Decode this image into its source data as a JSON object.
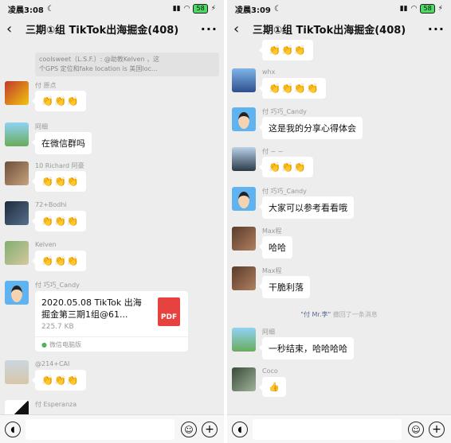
{
  "left": {
    "status": {
      "time": "凌晨3:08",
      "battery": "58"
    },
    "title": "三期①组 TikTok出海掘金(408)",
    "quote": {
      "line1": "coolsweet（L.S.F.）: @助教Kelven ，这",
      "line2": "个GPS 定位和fake location is  美国loc..."
    },
    "messages": [
      {
        "sender": "付 原点",
        "text": "👏👏👏"
      },
      {
        "sender": "阿细",
        "text": "在微信群吗"
      },
      {
        "sender": "10 Richard 阿豪",
        "text": "👏👏👏"
      },
      {
        "sender": "72+Bodhi",
        "text": "👏👏👏"
      },
      {
        "sender": "Kelven",
        "text": "👏👏👏"
      },
      {
        "sender": "付 巧巧_Candy"
      },
      {
        "sender": "@214+CAI",
        "text": "👏👏👏"
      },
      {
        "sender": "付 Esperanza"
      }
    ],
    "file": {
      "name": "2020.05.08 TikTok 出海掘金第三期1组@61...",
      "size": "225.7 KB",
      "source": "微信电脑版",
      "icon_label": "PDF"
    }
  },
  "right": {
    "status": {
      "time": "凌晨3:09",
      "battery": "58"
    },
    "title": "三期①组 TikTok出海掘金(408)",
    "top_claps": "👏👏👏",
    "messages": [
      {
        "sender": "whx",
        "text": "👏👏👏👏"
      },
      {
        "sender": "付 巧巧_Candy",
        "text": "这是我的分享心得体会"
      },
      {
        "sender": "付 ~ ~",
        "text": "👏👏👏"
      },
      {
        "sender": "付 巧巧_Candy",
        "text": "大家可以参考看看哦"
      },
      {
        "sender": "Max程",
        "text": "哈哈"
      },
      {
        "sender": "Max程",
        "text": "干脆利落"
      },
      {
        "sender": "阿细",
        "text": "一秒结束，哈哈哈哈"
      },
      {
        "sender": "Coco",
        "text": "👍"
      }
    ],
    "recall": {
      "name": "\"付 Mr.李\"",
      "text": " 撤回了一条消息"
    }
  },
  "icons": {
    "back": "back-arrow-icon",
    "more": "more-dots-icon",
    "voice": "voice-icon",
    "emoji": "emoji-icon",
    "plus": "plus-icon"
  }
}
